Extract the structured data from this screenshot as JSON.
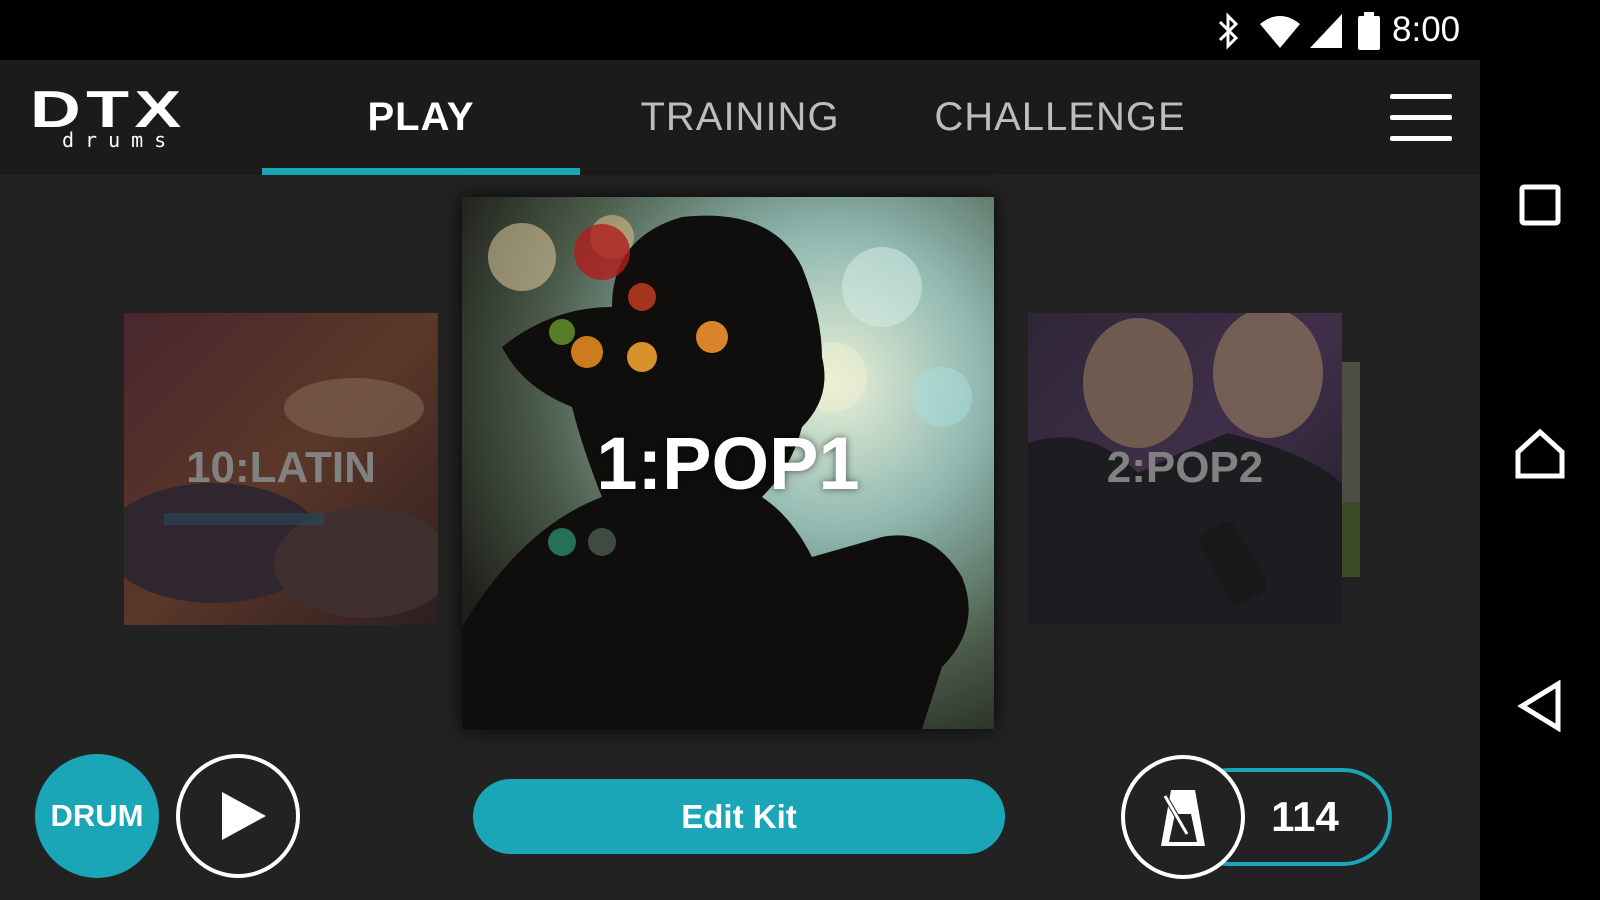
{
  "status_bar": {
    "time": "8:00",
    "icons": [
      "bluetooth-icon",
      "wifi-icon",
      "signal-icon",
      "battery-icon"
    ]
  },
  "app": {
    "logo": {
      "main": "DTX",
      "sub": "drums"
    },
    "tabs": [
      {
        "label": "PLAY",
        "active": true
      },
      {
        "label": "TRAINING",
        "active": false
      },
      {
        "label": "CHALLENGE",
        "active": false
      }
    ],
    "menu_icon": "hamburger-menu-icon"
  },
  "carousel": {
    "items": [
      {
        "label": "10:LATIN",
        "position": "previous"
      },
      {
        "label": "1:POP1",
        "position": "selected"
      },
      {
        "label": "2:POP2",
        "position": "next"
      }
    ]
  },
  "controls": {
    "drum_label": "DRUM",
    "play_icon": "play-icon",
    "edit_kit_label": "Edit Kit",
    "metronome_icon": "metronome-icon",
    "tempo": "114"
  },
  "nav_bar": {
    "buttons": [
      "recents-icon",
      "home-icon",
      "back-icon"
    ]
  },
  "colors": {
    "accent": "#1aa6b7",
    "background": "#222222",
    "header": "#1b1b1b"
  }
}
